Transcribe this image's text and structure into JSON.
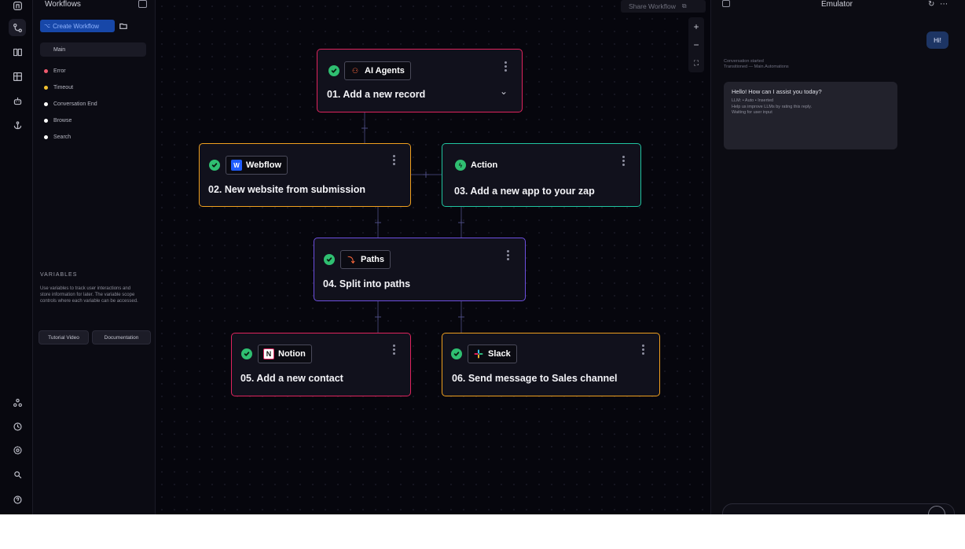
{
  "sidebar": {
    "title": "Workflows",
    "create_label": "Create Workflow",
    "main_label": "Main",
    "flows": [
      {
        "label": "Error",
        "color": "#f05a6e"
      },
      {
        "label": "Timeout",
        "color": "#f2c230"
      },
      {
        "label": "Conversation End",
        "color": "#ffffff"
      },
      {
        "label": "Browse",
        "color": "#ffffff"
      },
      {
        "label": "Search",
        "color": "#ffffff"
      }
    ],
    "variables_title": "VARIABLES",
    "variables_desc": "Use variables to track user interactions and store information for later. The variable scope controls where each variable can be accessed.",
    "tutorial_label": "Tutorial Video",
    "docs_label": "Documentation"
  },
  "rail": {
    "top_icons": [
      "home-icon",
      "workflows-icon",
      "book-icon",
      "table-icon",
      "bot-icon",
      "anchor-icon"
    ],
    "bottom_icons": [
      "integrations-icon",
      "history-icon",
      "settings-icon",
      "search-icon",
      "help-icon"
    ]
  },
  "canvas": {
    "share_label": "Share Workflow",
    "zoom_in": "+",
    "zoom_out": "−",
    "fit": "⛶"
  },
  "nodes": [
    {
      "app": "AI Agents",
      "title": "01. Add a new record",
      "border": "#e0245e",
      "icon": "ai-agents-icon",
      "status": "done"
    },
    {
      "app": "Webflow",
      "title": "02. New website from submission",
      "border": "#f0a01f",
      "icon": "webflow-icon",
      "status": "done"
    },
    {
      "app": "Action",
      "title": "03. Add a new app to your zap",
      "border": "#20c4a0",
      "icon": "action-icon",
      "status": "none"
    },
    {
      "app": "Paths",
      "title": "04. Split into paths",
      "border": "#6d4fe0",
      "icon": "paths-icon",
      "status": "done"
    },
    {
      "app": "Notion",
      "title": "05. Add a new contact",
      "border": "#e0245e",
      "icon": "notion-icon",
      "status": "done"
    },
    {
      "app": "Slack",
      "title": "06. Send message to Sales channel",
      "border": "#f0a01f",
      "icon": "slack-icon",
      "status": "done"
    }
  ],
  "emulator": {
    "title": "Emulator",
    "user_message": "Hi!",
    "meta_line1": "Conversation started",
    "meta_line2": "Transitioned — Main.Automations",
    "bot_greeting": "Hello! How can I assist you today?",
    "bot_line1": "LLM: • Auto • Inserted",
    "bot_line2": "Help us improve LLMs by rating this reply.",
    "bot_line3": "Waiting for user input"
  }
}
